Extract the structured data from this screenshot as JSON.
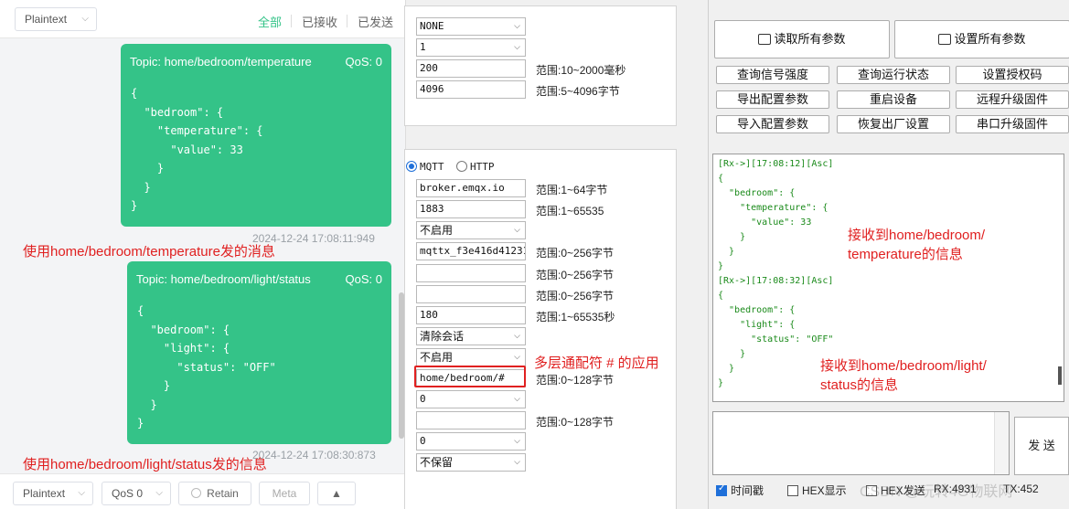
{
  "mqttx": {
    "format_select": "Plaintext",
    "filters": [
      "全部",
      "已接收",
      "已发送"
    ],
    "messages": [
      {
        "topic_label": "Topic: home/bedroom/temperature",
        "qos_label": "QoS: 0",
        "payload": "{\n  \"bedroom\": {\n    \"temperature\": {\n      \"value\": 33\n    }\n  }\n}",
        "time": "2024-12-24 17:08:11:949"
      },
      {
        "topic_label": "Topic: home/bedroom/light/status",
        "qos_label": "QoS: 0",
        "payload": "{\n  \"bedroom\": {\n    \"light\": {\n      \"status\": \"OFF\"\n    }\n  }\n}",
        "time": "2024-12-24 17:08:30:873"
      }
    ],
    "bottom": {
      "format": "Plaintext",
      "qos": "QoS 0",
      "retain": "Retain",
      "meta": "Meta"
    }
  },
  "annotations": {
    "temp_sent": "使用home/bedroom/temperature发的消息",
    "light_sent": "使用home/bedroom/light/status发的信息",
    "wildcard": "多层通配符 # 的应用",
    "recv_temp_1": "接收到home/bedroom/",
    "recv_temp_2": "temperature的信息",
    "recv_light_1": "接收到home/bedroom/light/",
    "recv_light_2": "status的信息"
  },
  "config": {
    "top_fields": [
      {
        "value": "NONE",
        "dropdown": true,
        "range": ""
      },
      {
        "value": "1",
        "dropdown": true,
        "range": ""
      },
      {
        "value": "200",
        "dropdown": false,
        "range": "范围:10~2000毫秒"
      },
      {
        "value": "4096",
        "dropdown": false,
        "range": "范围:5~4096字节"
      }
    ],
    "protocol": {
      "mqtt": "MQTT",
      "http": "HTTP"
    },
    "mqtt_fields": [
      {
        "value": "broker.emqx.io",
        "dropdown": false,
        "range": "范围:1~64字节"
      },
      {
        "value": "1883",
        "dropdown": false,
        "range": "范围:1~65535"
      },
      {
        "value": "不启用",
        "dropdown": true,
        "range": ""
      },
      {
        "value": "mqttx_f3e416d412313",
        "dropdown": false,
        "range": "范围:0~256字节"
      },
      {
        "value": "",
        "dropdown": false,
        "range": "范围:0~256字节"
      },
      {
        "value": "",
        "dropdown": false,
        "range": "范围:0~256字节"
      },
      {
        "value": "180",
        "dropdown": false,
        "range": "范围:1~65535秒"
      },
      {
        "value": "清除会话",
        "dropdown": true,
        "range": ""
      },
      {
        "value": "不启用",
        "dropdown": true,
        "range": ""
      },
      {
        "value": "home/bedroom/#",
        "dropdown": false,
        "range": "范围:0~128字节"
      },
      {
        "value": "0",
        "dropdown": true,
        "range": ""
      },
      {
        "value": "",
        "dropdown": false,
        "range": "范围:0~128字节"
      },
      {
        "value": "0",
        "dropdown": true,
        "range": ""
      },
      {
        "value": "不保留",
        "dropdown": true,
        "range": ""
      }
    ]
  },
  "tool": {
    "read_all": "读取所有参数",
    "set_all": "设置所有参数",
    "buttons": [
      "查询信号强度",
      "查询运行状态",
      "设置授权码",
      "导出配置参数",
      "重启设备",
      "远程升级固件",
      "导入配置参数",
      "恢复出厂设置",
      "串口升级固件"
    ],
    "log": "[Rx->][17:08:12][Asc]\n{\n  \"bedroom\": {\n    \"temperature\": {\n      \"value\": 33\n    }\n  }\n}\n[Rx->][17:08:32][Asc]\n{\n  \"bedroom\": {\n    \"light\": {\n      \"status\": \"OFF\"\n    }\n  }\n}",
    "send": "发 送",
    "timestamp": "时间戳",
    "hex_display": "HEX显示",
    "hex_send": "HEX发送",
    "rx": "RX:4931",
    "tx": "TX:452"
  },
  "watermark": "CSDN @玩转4G物联网"
}
